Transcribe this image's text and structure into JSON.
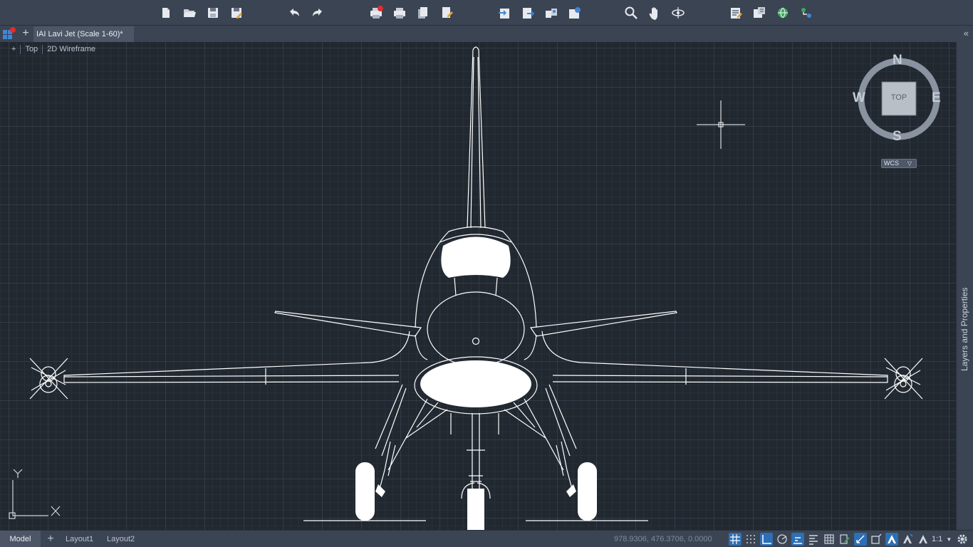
{
  "toolbar": {
    "buttons": [
      {
        "name": "new-icon",
        "label": "New"
      },
      {
        "name": "open-icon",
        "label": "Open"
      },
      {
        "name": "save-icon",
        "label": "Save"
      },
      {
        "name": "save-as-icon",
        "label": "Save As"
      },
      {
        "name": "undo-icon",
        "label": "Undo"
      },
      {
        "name": "redo-icon",
        "label": "Redo"
      },
      {
        "name": "plot-icon",
        "label": "Plot"
      },
      {
        "name": "print-icon",
        "label": "Print"
      },
      {
        "name": "publish-icon",
        "label": "Publish"
      },
      {
        "name": "page-setup-icon",
        "label": "Page Setup"
      },
      {
        "name": "import-icon",
        "label": "Import"
      },
      {
        "name": "export-icon",
        "label": "Export"
      },
      {
        "name": "share-icon",
        "label": "Share"
      },
      {
        "name": "sheet-set-icon",
        "label": "Sheet Set"
      },
      {
        "name": "zoom-icon",
        "label": "Zoom"
      },
      {
        "name": "pan-icon",
        "label": "Pan"
      },
      {
        "name": "orbit-icon",
        "label": "Orbit"
      },
      {
        "name": "properties-icon",
        "label": "Properties"
      },
      {
        "name": "design-center-icon",
        "label": "Design Center"
      },
      {
        "name": "web-icon",
        "label": "Web"
      },
      {
        "name": "cloud-icon",
        "label": "Cloud"
      }
    ]
  },
  "tabs": {
    "document_title": "IAI Lavi Jet (Scale 1-60)*",
    "new_tab": "+",
    "collapse": "«"
  },
  "viewport": {
    "controls": [
      "+",
      "Top",
      "2D Wireframe"
    ]
  },
  "viewcube": {
    "north": "N",
    "south": "S",
    "east": "E",
    "west": "W",
    "face": "TOP",
    "wcs_label": "WCS"
  },
  "ucs": {
    "x_label": "X",
    "y_label": "Y"
  },
  "right_panel": {
    "label": "Layers and Properties"
  },
  "statusbar": {
    "layout_tabs": [
      "Model",
      "Layout1",
      "Layout2"
    ],
    "add_layout": "+",
    "coordinates": "978.9306, 476.3706, 0.0000",
    "scale": "1:1"
  },
  "colors": {
    "canvas_bg": "#212830",
    "toolbar_bg": "#3b4453",
    "drawing_line": "#ffffff",
    "accent": "#2d6fb5",
    "alert": "#e02d2d"
  }
}
